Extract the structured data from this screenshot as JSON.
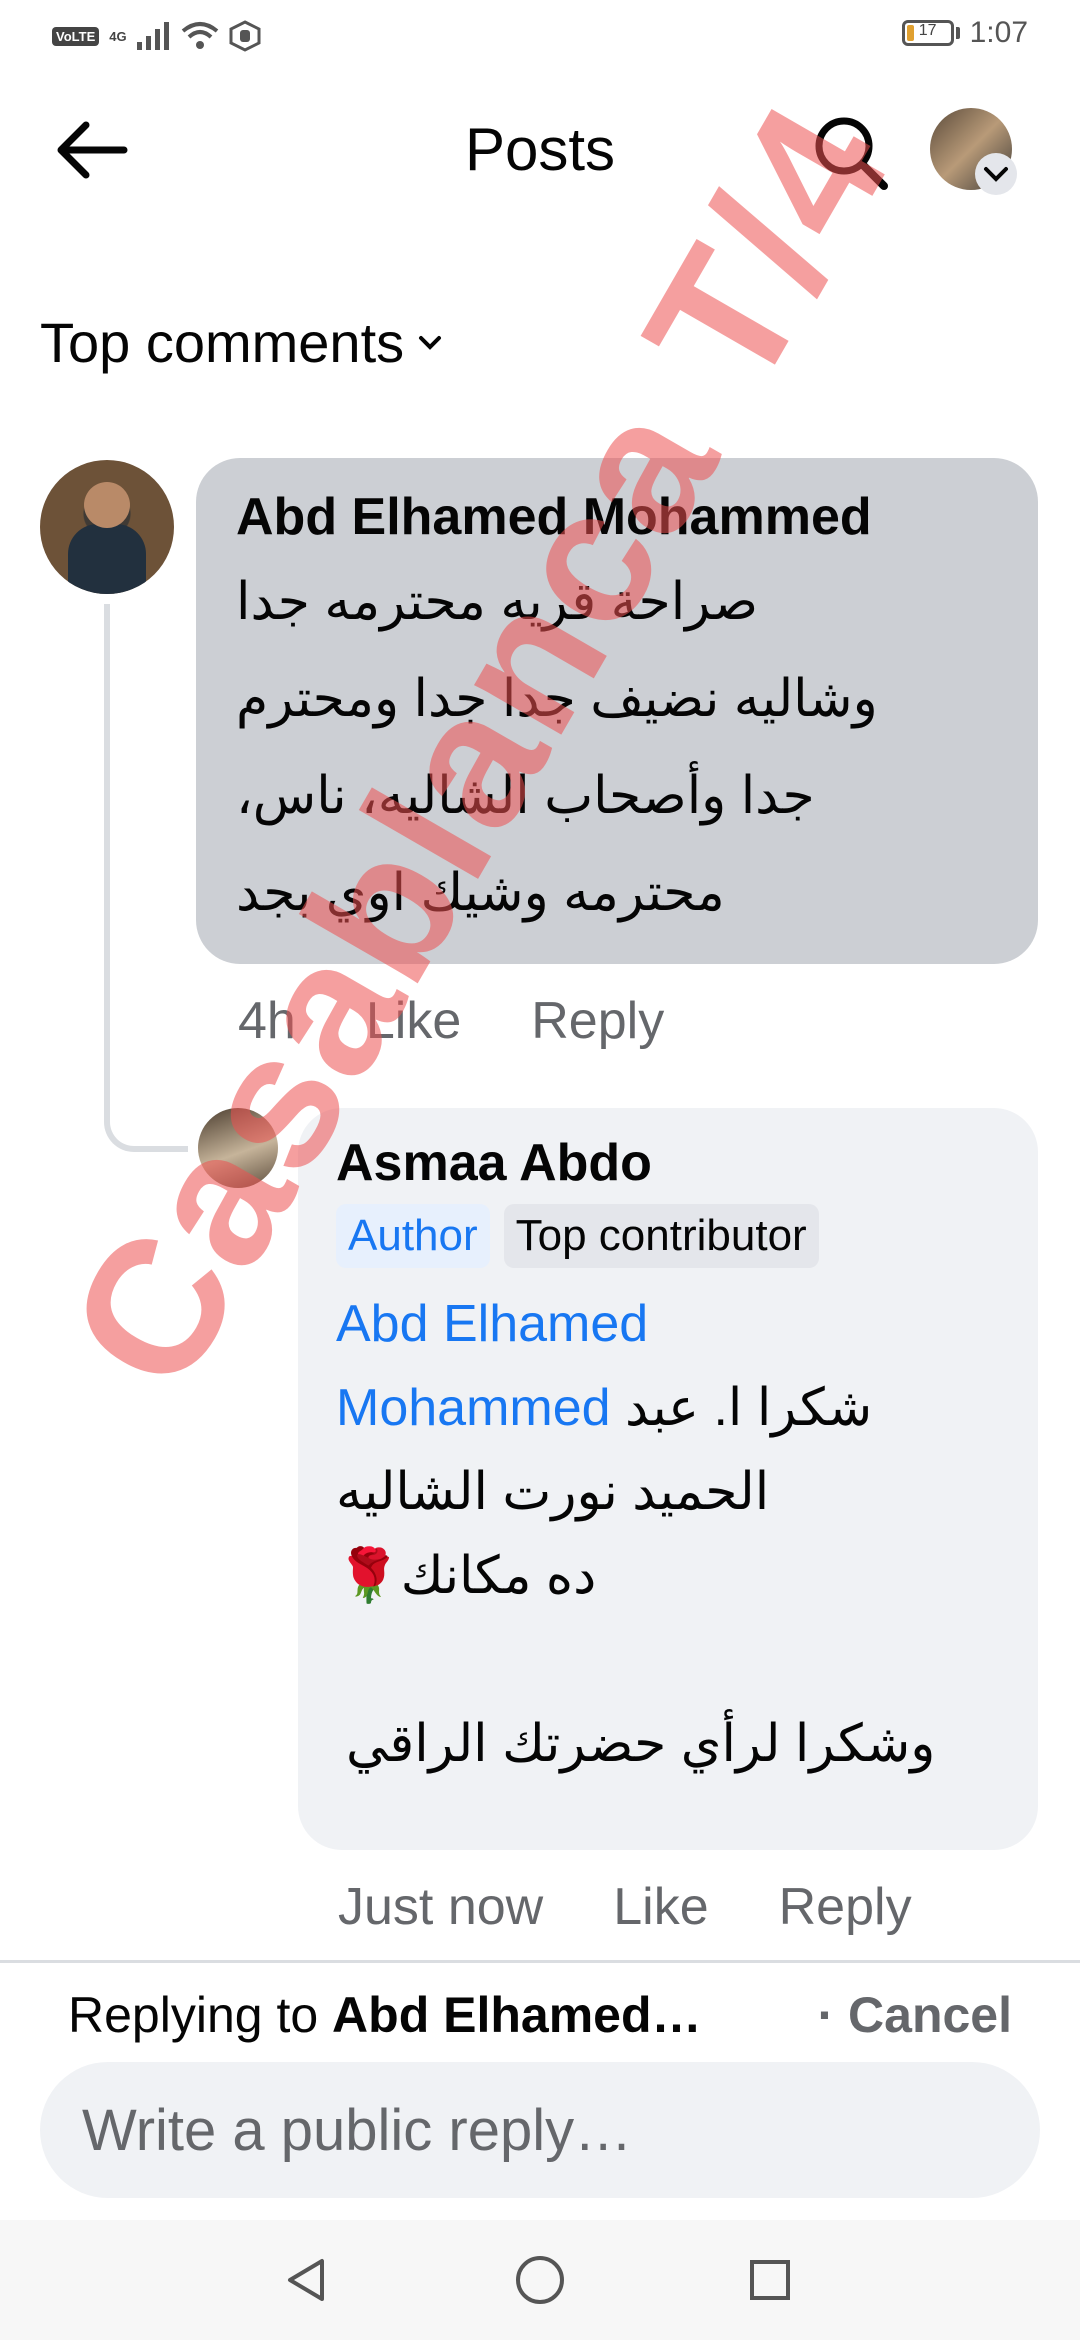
{
  "status_bar": {
    "volte": "VoLTE",
    "network": "4G",
    "battery": "17",
    "time": "1:07"
  },
  "header": {
    "title": "Posts"
  },
  "filter": {
    "label": "Top comments"
  },
  "comments": [
    {
      "author": "Abd Elhamed Mohammed",
      "text_lines": [
        "صراحة قريه محترمه جدا",
        "وشاليه نضيف جدا جدا ومحترم",
        "جدا وأصحاب الشاليه، ناس،",
        "محترمه وشيك اوي بجد"
      ],
      "time": "4h",
      "like": "Like",
      "reply": "Reply"
    }
  ],
  "reply": {
    "author": "Asmaa Abdo",
    "badges": [
      "Author",
      "Top contributor"
    ],
    "mention_line1": "Abd Elhamed",
    "mention_line2": "Mohammed",
    "text_line2_tail": "شكرا ا. عبد",
    "text_line3": "الحميد نورت الشاليه",
    "text_line4": "ده مكانك🌹",
    "text_line5": "وشكرا لرأي حضرتك  الراقي",
    "time": "Just now",
    "like": "Like",
    "reply": "Reply"
  },
  "composer": {
    "replying_prefix": "Replying to ",
    "replying_name": "Abd Elhamed…",
    "cancel": "· Cancel",
    "placeholder": "Write a public reply…"
  },
  "watermark": "Casablanca T/4",
  "colors": {
    "link_blue": "#1877f2",
    "bubble_dark": "#cccfd4",
    "bubble_light": "#f0f2f5",
    "secondary_text": "#65676b",
    "watermark_red": "#ec5050"
  }
}
